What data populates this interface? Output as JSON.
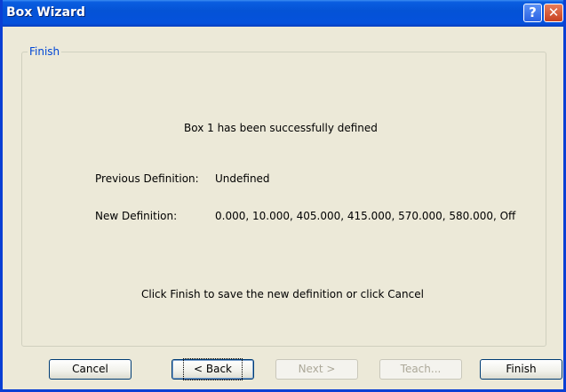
{
  "window": {
    "title": "Box Wizard",
    "help_symbol": "?",
    "close_symbol": "✕"
  },
  "group": {
    "label": "Finish"
  },
  "messages": {
    "success": "Box 1 has been successfully defined",
    "previous_label": "Previous Definition:",
    "previous_value": "Undefined",
    "new_label": "New Definition:",
    "new_value": "0.000, 10.000, 405.000, 415.000, 570.000, 580.000, Off",
    "footer": "Click Finish to save the new definition or click Cancel"
  },
  "buttons": {
    "cancel": "Cancel",
    "back": "< Back",
    "next": "Next >",
    "teach": "Teach...",
    "finish": "Finish"
  }
}
